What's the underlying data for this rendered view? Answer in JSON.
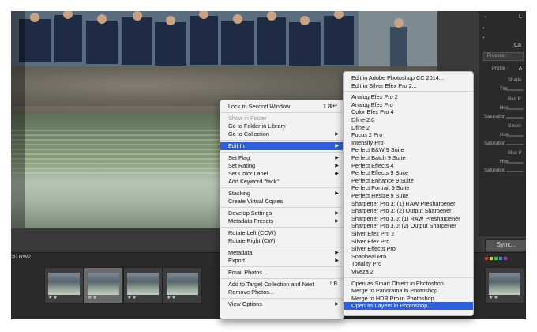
{
  "app": {
    "filename": "30.RW2",
    "sync_label": "Sync..."
  },
  "right_panel": {
    "labels": [
      "Process :",
      "Profile :",
      "Shado",
      "Tint",
      "Red P",
      "Hue",
      "Saturation",
      "Green",
      "Hue",
      "Saturation",
      "Blue P",
      "Hue",
      "Saturation"
    ],
    "partial": [
      "Ca",
      "A",
      "L"
    ]
  },
  "context_menu": {
    "items": [
      {
        "label": "Lock to Second Window",
        "shortcut": "⇧⌘↩",
        "disabled": false,
        "submenu": false
      },
      {
        "label": "Show in Finder",
        "shortcut": "",
        "disabled": true,
        "submenu": false
      },
      {
        "label": "Go to Folder in Library",
        "shortcut": "",
        "disabled": false,
        "submenu": false
      },
      {
        "label": "Go to Collection",
        "shortcut": "",
        "disabled": false,
        "submenu": true
      },
      {
        "label": "Edit In",
        "shortcut": "",
        "disabled": false,
        "submenu": true,
        "highlighted": true
      },
      {
        "label": "Set Flag",
        "shortcut": "",
        "disabled": false,
        "submenu": true
      },
      {
        "label": "Set Rating",
        "shortcut": "",
        "disabled": false,
        "submenu": true
      },
      {
        "label": "Set Color Label",
        "shortcut": "",
        "disabled": false,
        "submenu": true
      },
      {
        "label": "Add Keyword \"tack\"",
        "shortcut": "",
        "disabled": false,
        "submenu": false
      },
      {
        "label": "Stacking",
        "shortcut": "",
        "disabled": false,
        "submenu": true
      },
      {
        "label": "Create Virtual Copies",
        "shortcut": "",
        "disabled": false,
        "submenu": false
      },
      {
        "label": "Develop Settings",
        "shortcut": "",
        "disabled": false,
        "submenu": true
      },
      {
        "label": "Metadata Presets",
        "shortcut": "",
        "disabled": false,
        "submenu": true
      },
      {
        "label": "Rotate Left (CCW)",
        "shortcut": "",
        "disabled": false,
        "submenu": false
      },
      {
        "label": "Rotate Right (CW)",
        "shortcut": "",
        "disabled": false,
        "submenu": false
      },
      {
        "label": "Metadata",
        "shortcut": "",
        "disabled": false,
        "submenu": true
      },
      {
        "label": "Export",
        "shortcut": "",
        "disabled": false,
        "submenu": true
      },
      {
        "label": "Email Photos...",
        "shortcut": "",
        "disabled": false,
        "submenu": false
      },
      {
        "label": "Add to Target Collection and Next",
        "shortcut": "⇧B",
        "disabled": false,
        "submenu": false
      },
      {
        "label": "Remove Photos...",
        "shortcut": "",
        "disabled": false,
        "submenu": false
      },
      {
        "label": "View Options",
        "shortcut": "",
        "disabled": false,
        "submenu": true
      }
    ]
  },
  "submenu": {
    "items": [
      "Edit in Adobe Photoshop CC 2014...",
      "Edit in Silver Efex Pro 2...",
      "Analog Efex Pro 2",
      "Analog Efex Pro",
      "Color Efex Pro 4",
      "Dfine 2.0",
      "Dfine 2",
      "Focus 2 Pro",
      "Intensify Pro",
      "Perfect B&W 9 Suite",
      "Perfect Batch 9 Suite",
      "Perfect Effects 4",
      "Perfect Effects 9 Suite",
      "Perfect Enhance 9 Suite",
      "Perfect Portrait 9 Suite",
      "Perfect Resize 9 Suite",
      "Sharpener Pro 3: (1) RAW Presharpener",
      "Sharpener Pro 3: (2) Output Sharpener",
      "Sharpener Pro 3.0: (1) RAW Presharpener",
      "Sharpener Pro 3.0: (2) Output Sharpener",
      "Silver Efex Pro 2",
      "Silver Efex Pro",
      "Silver Effects Pro",
      "Snapheal Pro",
      "Tonality Pro",
      "Viveza 2",
      "Open as Smart Object in Photoshop...",
      "Merge to Panorama in Photoshop...",
      "Merge to HDR Pro in Photoshop...",
      "Open as Layers in Photoshop..."
    ],
    "highlighted_index": 29
  },
  "filmstrip": {
    "ratings": [
      "★★",
      "★★",
      "★★",
      "★★",
      "★★"
    ]
  },
  "colors": {
    "highlight": "#2f5fdb",
    "menu_bg": "#f2f2f2"
  }
}
